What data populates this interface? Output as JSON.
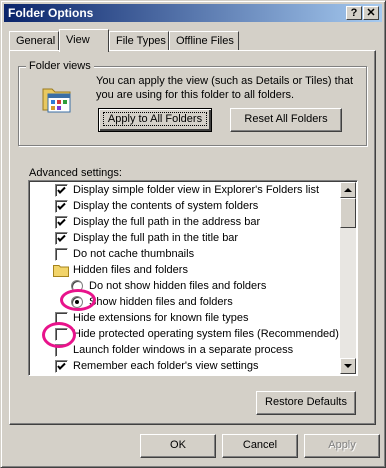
{
  "window": {
    "title": "Folder Options",
    "help_glyph": "?",
    "close_glyph": "✕"
  },
  "tabs": [
    {
      "label": "General"
    },
    {
      "label": "View"
    },
    {
      "label": "File Types"
    },
    {
      "label": "Offline Files"
    }
  ],
  "folder_views": {
    "label": "Folder views",
    "description": "You can apply the view (such as Details or Tiles) that you are using for this folder to all folders.",
    "apply_button": "Apply to All Folders",
    "reset_button": "Reset All Folders"
  },
  "advanced": {
    "label": "Advanced settings:",
    "items": [
      {
        "type": "checkbox",
        "checked": true,
        "label": "Display simple folder view in Explorer's Folders list"
      },
      {
        "type": "checkbox",
        "checked": true,
        "label": "Display the contents of system folders"
      },
      {
        "type": "checkbox",
        "checked": true,
        "label": "Display the full path in the address bar"
      },
      {
        "type": "checkbox",
        "checked": true,
        "label": "Display the full path in the title bar"
      },
      {
        "type": "checkbox",
        "checked": false,
        "label": "Do not cache thumbnails"
      },
      {
        "type": "folder",
        "label": "Hidden files and folders"
      },
      {
        "type": "radio",
        "checked": false,
        "label": "Do not show hidden files and folders"
      },
      {
        "type": "radio",
        "checked": true,
        "label": "Show hidden files and folders"
      },
      {
        "type": "checkbox",
        "checked": false,
        "label": "Hide extensions for known file types"
      },
      {
        "type": "checkbox",
        "checked": false,
        "label": "Hide protected operating system files (Recommended)"
      },
      {
        "type": "checkbox",
        "checked": false,
        "label": "Launch folder windows in a separate process"
      },
      {
        "type": "checkbox",
        "checked": true,
        "label": "Remember each folder's view settings"
      }
    ],
    "restore_button": "Restore Defaults"
  },
  "footer": {
    "ok": "OK",
    "cancel": "Cancel",
    "apply": "Apply"
  },
  "colors": {
    "highlight_ring": "#e8138b",
    "titlebar_start": "#0a246a",
    "titlebar_end": "#a6caf0"
  }
}
